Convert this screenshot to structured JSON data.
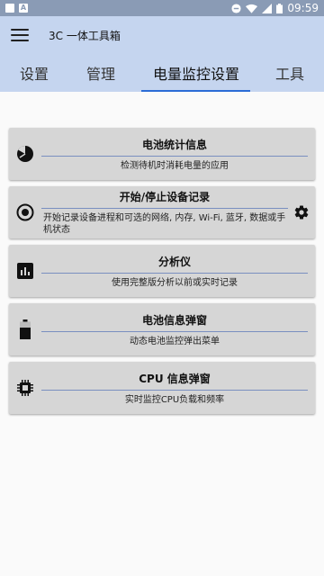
{
  "status_bar": {
    "left_icons": [
      "notification-square-icon",
      "notification-a-icon"
    ],
    "time": "09:59"
  },
  "app_bar": {
    "title": "3C 一体工具箱"
  },
  "tabs": [
    {
      "label": "设置"
    },
    {
      "label": "管理"
    },
    {
      "label": "电量监控设置",
      "active": true
    },
    {
      "label": "工具"
    }
  ],
  "cards": [
    {
      "title": "电池统计信息",
      "desc": "检测待机时消耗电量的应用",
      "icon": "pie-chart-icon"
    },
    {
      "title": "开始/停止设备记录",
      "desc": "开始记录设备进程和可选的网络, 内存, Wi-Fi, 蓝牙, 数据或手机状态",
      "icon": "record-icon",
      "settings_icon": "gear-icon"
    },
    {
      "title": "分析仪",
      "desc": "使用完整版分析以前或实时记录",
      "icon": "bar-chart-icon"
    },
    {
      "title": "电池信息弹窗",
      "desc": "动态电池监控弹出菜单",
      "icon": "battery-icon"
    },
    {
      "title": "CPU 信息弹窗",
      "desc": "实时监控CPU负载和频率",
      "icon": "cpu-chip-icon"
    }
  ],
  "colors": {
    "accent": "#2b6cd6",
    "appbar": "#c5d5ef",
    "statusbar": "#8a9bb5",
    "card": "#d6d6d6"
  }
}
